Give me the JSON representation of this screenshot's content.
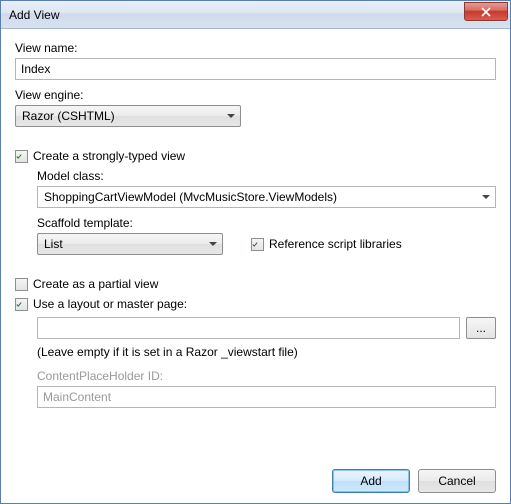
{
  "window": {
    "title": "Add View"
  },
  "viewName": {
    "label": "View name:",
    "value": "Index"
  },
  "viewEngine": {
    "label": "View engine:",
    "value": "Razor (CSHTML)"
  },
  "stronglyTyped": {
    "label": "Create a strongly-typed view",
    "checked": true
  },
  "modelClass": {
    "label": "Model class:",
    "value": "ShoppingCartViewModel (MvcMusicStore.ViewModels)"
  },
  "scaffold": {
    "label": "Scaffold template:",
    "value": "List"
  },
  "refScripts": {
    "label": "Reference script libraries",
    "checked": true
  },
  "partial": {
    "label": "Create as a partial view",
    "checked": false
  },
  "layout": {
    "label": "Use a layout or master page:",
    "checked": true,
    "value": "",
    "browse": "...",
    "hint": "(Leave empty if it is set in a Razor _viewstart file)"
  },
  "placeholder": {
    "label": "ContentPlaceHolder ID:",
    "value": "MainContent"
  },
  "buttons": {
    "add": "Add",
    "cancel": "Cancel"
  }
}
